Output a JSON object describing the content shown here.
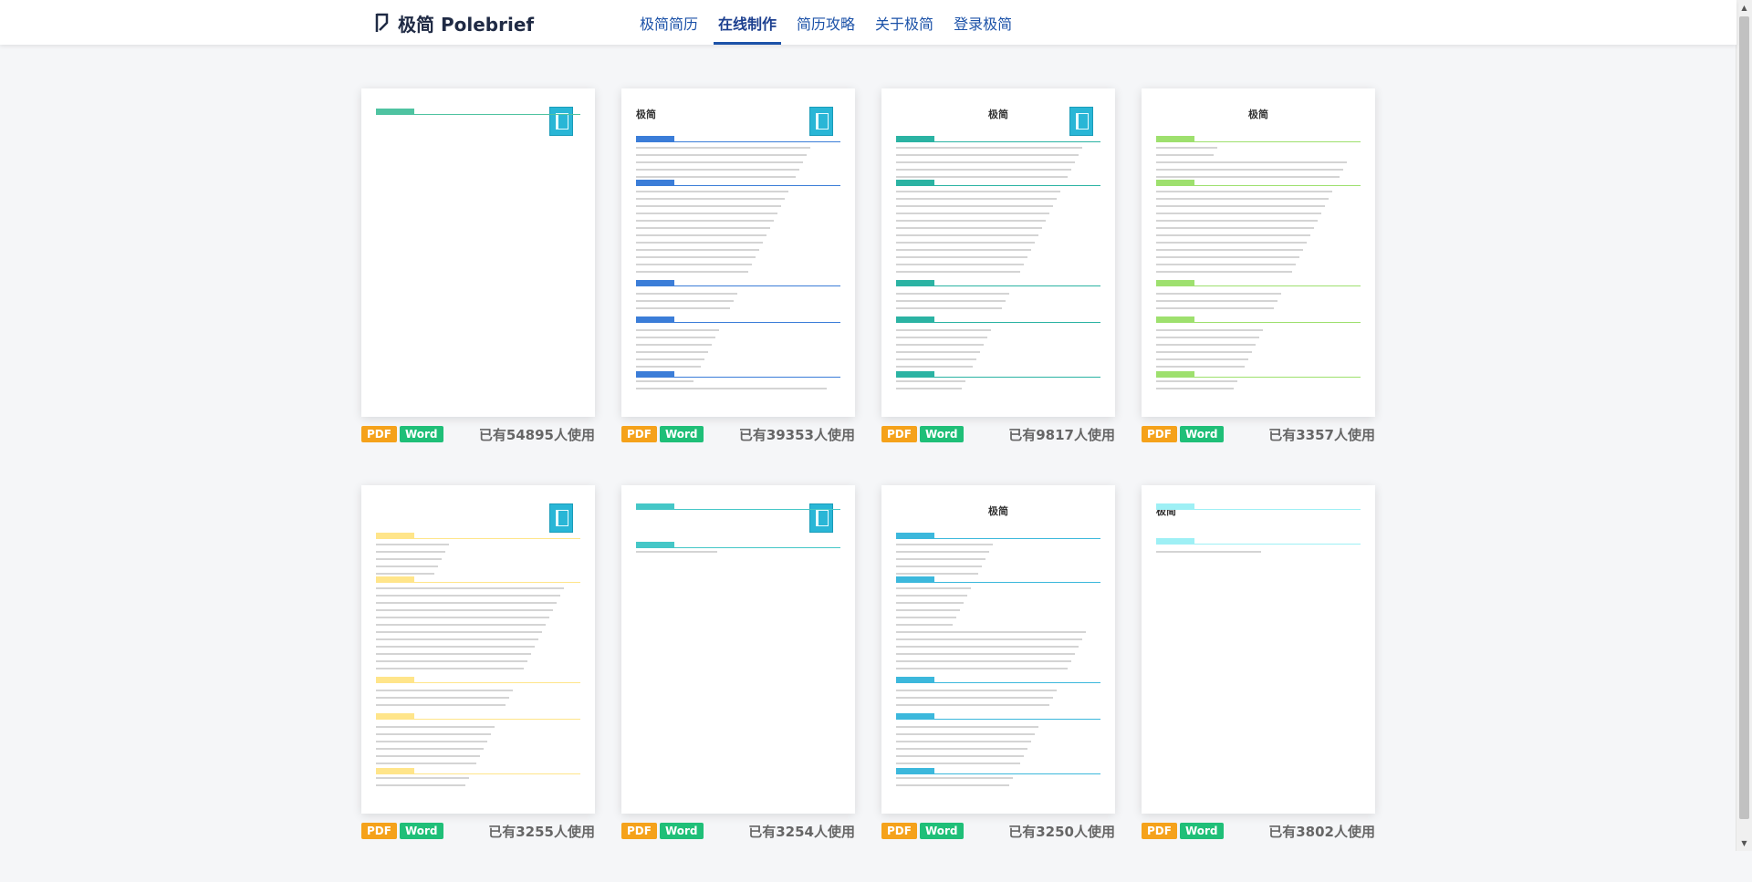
{
  "header": {
    "logo_text": "极简 Polebrief",
    "nav": [
      {
        "label": "极简简历",
        "active": false
      },
      {
        "label": "在线制作",
        "active": true
      },
      {
        "label": "简历攻略",
        "active": false
      },
      {
        "label": "关于极简",
        "active": false
      },
      {
        "label": "登录极简",
        "active": false
      }
    ]
  },
  "badges": {
    "pdf": "PDF",
    "word": "Word"
  },
  "templates": [
    {
      "usage": "已有54895人使用",
      "accent": "#4fc3a1",
      "name": ""
    },
    {
      "usage": "已有39353人使用",
      "accent": "#3b7dd8",
      "name": "极简"
    },
    {
      "usage": "已有9817人使用",
      "accent": "#2bb3a3",
      "name": "极简"
    },
    {
      "usage": "已有3357人使用",
      "accent": "#9ee06e",
      "name": "极简"
    },
    {
      "usage": "已有3255人使用",
      "accent": "#ffe58a",
      "name": ""
    },
    {
      "usage": "已有3254人使用",
      "accent": "#45c7c7",
      "name": ""
    },
    {
      "usage": "已有3250人使用",
      "accent": "#3cb8dc",
      "name": "极简"
    },
    {
      "usage": "已有3802人使用",
      "accent": "#9ef0f5",
      "name": "极简"
    }
  ],
  "colors": {
    "primary": "#1c52a8",
    "pdf": "#f5a21b",
    "word": "#1fbf78"
  }
}
